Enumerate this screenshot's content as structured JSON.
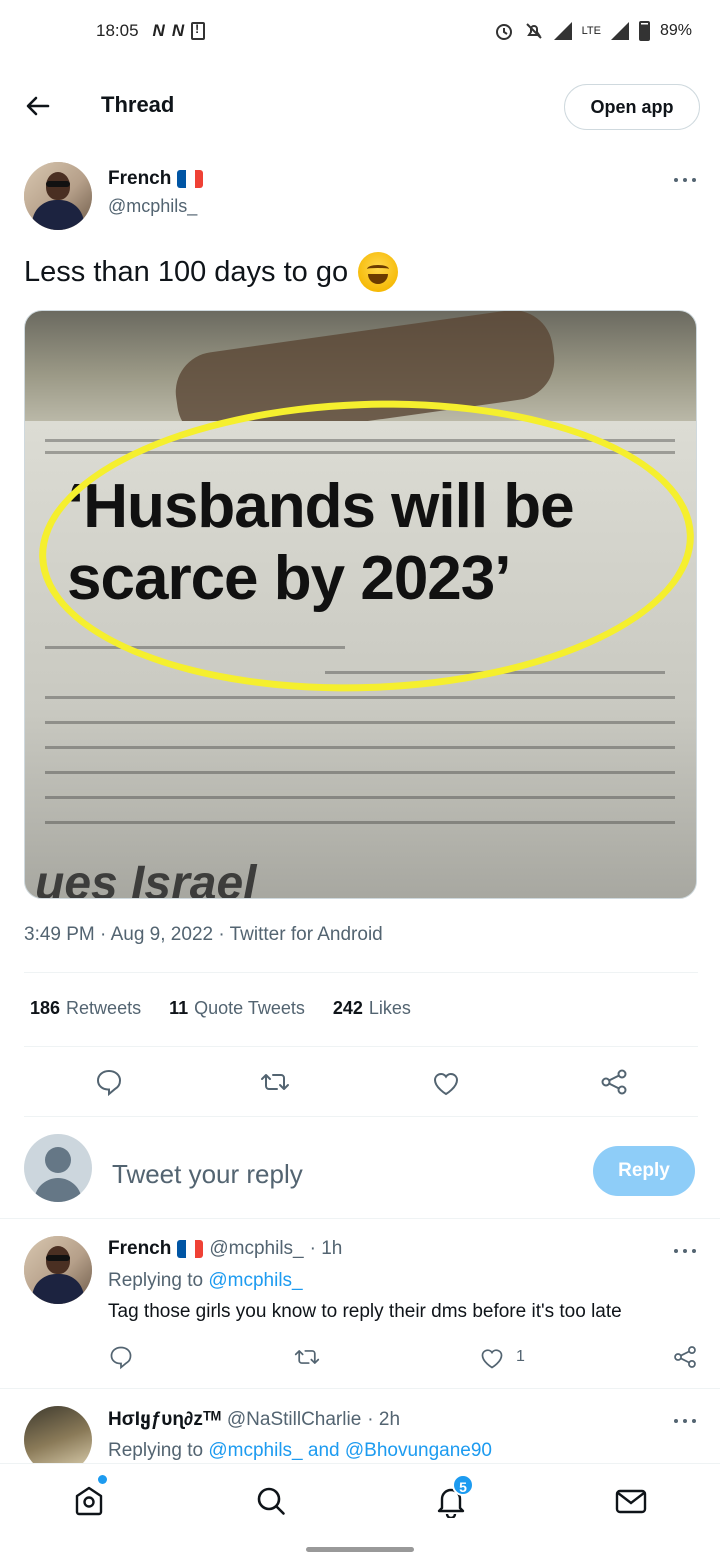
{
  "status_bar": {
    "time": "18:05",
    "notif_icons": [
      "N",
      "N"
    ],
    "network": "LTE",
    "battery": "89%"
  },
  "header": {
    "title": "Thread",
    "open_app": "Open app"
  },
  "tweet": {
    "author_name": "French",
    "author_handle": "@mcphils_",
    "text": "Less than 100 days to go",
    "image_headline_1": "‘Husbands will be",
    "image_headline_2": "scarce by 2023’",
    "image_bottom_text": "ues Israel",
    "meta": "3:49 PM · Aug 9, 2022 · Twitter for Android",
    "stats": [
      {
        "count": "186",
        "label": "Retweets"
      },
      {
        "count": "11",
        "label": "Quote Tweets"
      },
      {
        "count": "242",
        "label": "Likes"
      }
    ]
  },
  "composer": {
    "placeholder": "Tweet your reply",
    "button": "Reply"
  },
  "replies": [
    {
      "name": "French",
      "handle": "@mcphils_",
      "time": "· 1h",
      "replying_prefix": "Replying to ",
      "replying_to": "@mcphils_",
      "text": "Tag those girls you know to reply their dms before it's too late",
      "like_count": "1"
    },
    {
      "name": "HσƖყƒυɳ∂zᵀᴹ",
      "handle": "@NaStillCharlie",
      "time": "· 2h",
      "replying_prefix": "Replying to ",
      "replying_to": "@mcphils_ and @Bhovungane90"
    }
  ],
  "nav": {
    "notification_badge": "5"
  },
  "colors": {
    "accent": "#1d9bf0",
    "reply_button": "#8ecdf8",
    "secondary_text": "#536471",
    "highlight": "#f5ef2e"
  }
}
